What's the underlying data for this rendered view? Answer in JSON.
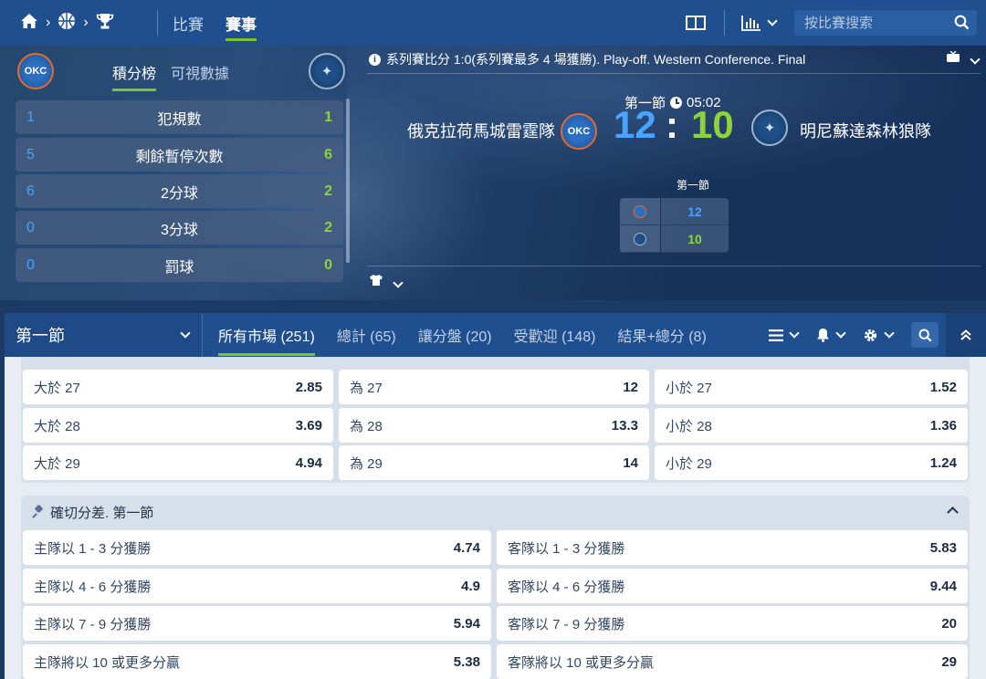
{
  "nav": {
    "crumb_icons": [
      "home-icon",
      "chevron-right-icon",
      "basketball-icon",
      "chevron-right-icon",
      "trophy-icon"
    ],
    "tabs": [
      {
        "label": "比賽",
        "active": false
      },
      {
        "label": "賽事",
        "active": true
      }
    ],
    "search_placeholder": "按比賽搜索"
  },
  "left_panel": {
    "tabs": [
      {
        "label": "積分榜",
        "active": true
      },
      {
        "label": "可視數據",
        "active": false
      }
    ],
    "stats": [
      {
        "home": "1",
        "name": "犯規數",
        "away": "1"
      },
      {
        "home": "5",
        "name": "剩餘暫停次數",
        "away": "6"
      },
      {
        "home": "6",
        "name": "2分球",
        "away": "2"
      },
      {
        "home": "0",
        "name": "3分球",
        "away": "2"
      },
      {
        "home": "0",
        "name": "罰球",
        "away": "0"
      }
    ]
  },
  "match": {
    "info": "系列賽比分 1:0(系列賽最多 4 場獲勝). Play-off. Western Conference. Final",
    "period": "第一節",
    "clock": "05:02",
    "home_team": "俄克拉荷馬城雷霆隊",
    "away_team": "明尼蘇達森林狼隊",
    "home_score": "12",
    "away_score": "10",
    "separator": ":",
    "mini_table": {
      "title": "第一節",
      "home": "12",
      "away": "10"
    }
  },
  "markets_bar": {
    "period_select": "第一節",
    "tabs": [
      {
        "label": "所有市場 (251)",
        "active": true
      },
      {
        "label": "總計 (65)",
        "active": false
      },
      {
        "label": "讓分盤 (20)",
        "active": false
      },
      {
        "label": "受歡迎 (148)",
        "active": false
      },
      {
        "label": "結果+總分 (8)",
        "active": false
      }
    ]
  },
  "totals": {
    "rows": [
      [
        {
          "label": "大於 27",
          "odd": "2.85"
        },
        {
          "label": "為 27",
          "odd": "12"
        },
        {
          "label": "小於 27",
          "odd": "1.52"
        }
      ],
      [
        {
          "label": "大於 28",
          "odd": "3.69"
        },
        {
          "label": "為 28",
          "odd": "13.3"
        },
        {
          "label": "小於 28",
          "odd": "1.36"
        }
      ],
      [
        {
          "label": "大於 29",
          "odd": "4.94"
        },
        {
          "label": "為 29",
          "odd": "14"
        },
        {
          "label": "小於 29",
          "odd": "1.24"
        }
      ]
    ]
  },
  "margin": {
    "title": "確切分差. 第一節",
    "rows": [
      [
        {
          "label": "主隊以 1 - 3 分獲勝",
          "odd": "4.74"
        },
        {
          "label": "客隊以 1 - 3 分獲勝",
          "odd": "5.83"
        }
      ],
      [
        {
          "label": "主隊以 4 - 6 分獲勝",
          "odd": "4.9"
        },
        {
          "label": "客隊以 4 - 6 分獲勝",
          "odd": "9.44"
        }
      ],
      [
        {
          "label": "主隊以 7 - 9 分獲勝",
          "odd": "5.94"
        },
        {
          "label": "客隊以 7 - 9 分獲勝",
          "odd": "20"
        }
      ],
      [
        {
          "label": "主隊將以 10 或更多分贏",
          "odd": "5.38"
        },
        {
          "label": "客隊將以 10 或更多分贏",
          "odd": "29"
        }
      ]
    ]
  },
  "colors": {
    "home_accent": "#4aa3ff",
    "away_accent": "#8dd33a",
    "nav_bg": "#1f4f8f",
    "active_underline": "#7cc42a"
  }
}
